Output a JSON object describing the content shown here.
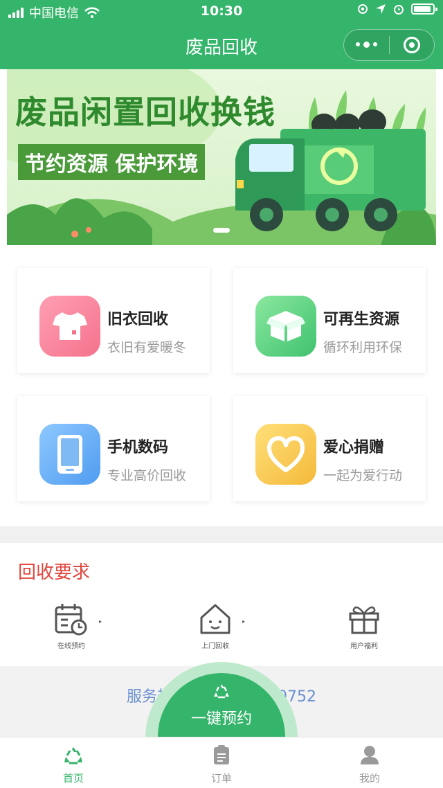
{
  "status_bar": {
    "carrier": "中国电信",
    "time": "10:30"
  },
  "nav": {
    "title": "废品回收"
  },
  "banner": {
    "headline": "废品闲置回收换钱",
    "subline": "节约资源 保护环境"
  },
  "categories": [
    {
      "title": "旧衣回收",
      "desc": "衣旧有爱暖冬",
      "icon": "tshirt-icon",
      "color": "#f47f95"
    },
    {
      "title": "可再生资源",
      "desc": "循环利用环保",
      "icon": "box-icon",
      "color": "#44c777"
    },
    {
      "title": "手机数码",
      "desc": "专业高价回收",
      "icon": "phone-icon",
      "color": "#5aa5f0"
    },
    {
      "title": "爱心捐赠",
      "desc": "一起为爱行动",
      "icon": "heart-icon",
      "color": "#f7c448"
    }
  ],
  "requirements": {
    "title": "回收要求",
    "steps": [
      {
        "label": "在线预约",
        "icon": "calendar-icon"
      },
      {
        "label": "上门回收",
        "icon": "house-icon"
      },
      {
        "label": "用户福利",
        "icon": "gift-icon"
      }
    ]
  },
  "hotline": {
    "text_left": "服务热",
    "text_right": "0-0752"
  },
  "fab": {
    "label": "一键预约",
    "icon": "recycle-icon"
  },
  "tabs": [
    {
      "label": "首页",
      "icon": "recycle-icon",
      "active": true
    },
    {
      "label": "订单",
      "icon": "clipboard-icon",
      "active": false
    },
    {
      "label": "我的",
      "icon": "user-icon",
      "active": false
    }
  ],
  "colors": {
    "primary": "#35b46b",
    "section_title": "#e2463d",
    "hotline": "#6a8fd0"
  }
}
